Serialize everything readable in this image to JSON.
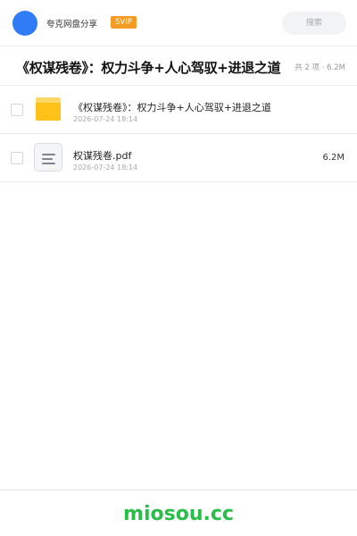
{
  "header": {
    "share_name": "夸克网盘分享",
    "badge": "SVIP",
    "search_placeholder": "搜索"
  },
  "title_row": {
    "title": "《权谋残卷》：权力斗争+人心驾驭+进退之道",
    "count": "共 2 项 · 6.2M"
  },
  "files": [
    {
      "type": "folder",
      "icon": "folder-icon",
      "name": "《权谋残卷》：权力斗争+人心驾驭+进退之道",
      "date": "2026-07-24 18:14",
      "size": ""
    },
    {
      "type": "pdf",
      "icon": "document-icon",
      "name": "权谋残卷.pdf",
      "date": "2026-07-24 18:14",
      "size": "6.2M"
    }
  ],
  "footer": {
    "brand": "miosou.cc"
  },
  "colors": {
    "accent_blue": "#2f7cf6",
    "svip_orange": "#f59a23",
    "folder_yellow": "#ffc21a",
    "brand_green": "#2bbd4a"
  }
}
